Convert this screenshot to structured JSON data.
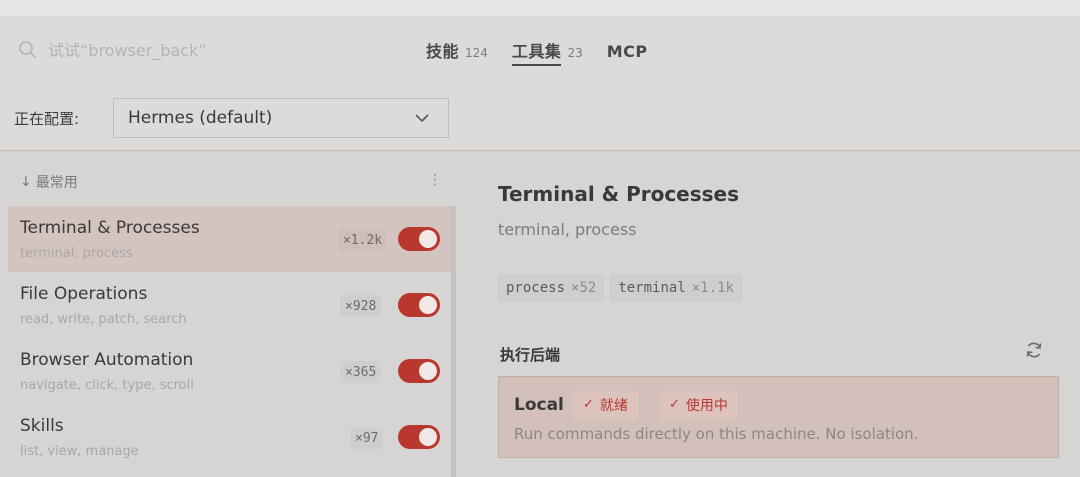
{
  "search": {
    "placeholder": "试试“browser_back”"
  },
  "tabs": [
    {
      "label": "技能",
      "count": "124"
    },
    {
      "label": "工具集",
      "count": "23"
    },
    {
      "label": "MCP",
      "count": ""
    }
  ],
  "config": {
    "label": "正在配置:",
    "selected": "Hermes (default)"
  },
  "list": {
    "section_label": "最常用",
    "kebab": "⋮",
    "items": [
      {
        "title": "Terminal & Processes",
        "subtitle": "terminal, process",
        "count": "×1.2k"
      },
      {
        "title": "File Operations",
        "subtitle": "read, write, patch, search",
        "count": "×928"
      },
      {
        "title": "Browser Automation",
        "subtitle": "navigate, click, type, scroll",
        "count": "×365"
      },
      {
        "title": "Skills",
        "subtitle": "list, view, manage",
        "count": "×97"
      }
    ]
  },
  "detail": {
    "title": "Terminal & Processes",
    "subtitle": "terminal, process",
    "chips": [
      {
        "name": "process",
        "count": "×52"
      },
      {
        "name": "terminal",
        "count": "×1.1k"
      }
    ],
    "backend_label": "执行后端",
    "backend": {
      "name": "Local",
      "badges": [
        "就绪",
        "使用中"
      ],
      "description": "Run commands directly on this machine. No isolation."
    }
  },
  "colors": {
    "accent": "#b8382f",
    "active_bg": "#d4c4bf"
  }
}
